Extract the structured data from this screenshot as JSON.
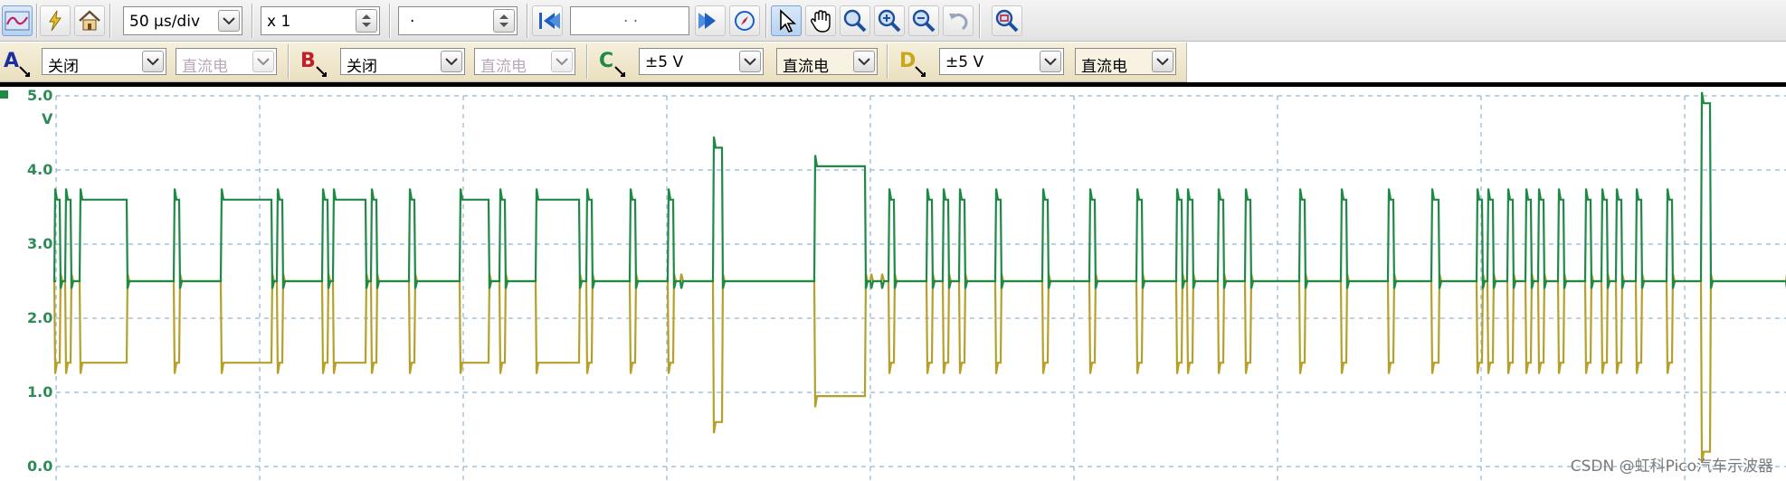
{
  "toolbar": {
    "timebase": "50 µs/div",
    "zoom_factor": "x 1",
    "offset_value": "·",
    "buffer_field": "· ·"
  },
  "channels": [
    {
      "letter": "A",
      "color": "#1c2fa0",
      "range": "关闭",
      "coupling": "直流电",
      "enabled": false
    },
    {
      "letter": "B",
      "color": "#c0202a",
      "range": "关闭",
      "coupling": "直流电",
      "enabled": false
    },
    {
      "letter": "C",
      "color": "#1e8a45",
      "range": "±5 V",
      "coupling": "直流电",
      "enabled": true
    },
    {
      "letter": "D",
      "color": "#c8a818",
      "range": "±5 V",
      "coupling": "直流电",
      "enabled": true
    }
  ],
  "scope": {
    "y_axis": {
      "unit": "V",
      "ticks": [
        "5.0",
        "4.0",
        "3.0",
        "2.0",
        "1.0",
        "0.0"
      ],
      "color": "#2e8b57"
    },
    "trace_colors": {
      "C": "#1e8a45",
      "D": "#b5a12a"
    },
    "grid_color": "#8fb6d6"
  },
  "watermark": "CSDN @虹科Pico汽车示波器"
}
